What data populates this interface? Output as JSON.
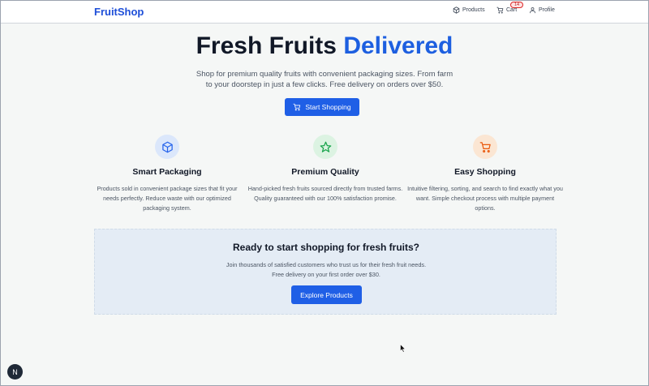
{
  "header": {
    "brand": "FruitShop",
    "nav": {
      "products": "Products",
      "cart": "Cart",
      "cart_count": "14",
      "profile": "Profile"
    }
  },
  "hero": {
    "title_main": "Fresh Fruits",
    "title_accent": "Delivered",
    "subtitle": "Shop for premium quality fruits with convenient packaging sizes. From farm to your doorstep in just a few clicks. Free delivery on orders over $50.",
    "cta_label": "Start Shopping"
  },
  "features": [
    {
      "icon": "package-icon",
      "title": "Smart Packaging",
      "description": "Products sold in convenient package sizes that fit your needs perfectly. Reduce waste with our optimized packaging system.",
      "color": "#2563eb",
      "bg": "#dbe7fb"
    },
    {
      "icon": "star-icon",
      "title": "Premium Quality",
      "description": "Hand-picked fresh fruits sourced directly from trusted farms. Quality guaranteed with our 100% satisfaction promise.",
      "color": "#16a34a",
      "bg": "#dcf3e2"
    },
    {
      "icon": "cart-icon",
      "title": "Easy Shopping",
      "description": "Intuitive filtering, sorting, and search to find exactly what you want. Simple checkout process with multiple payment options.",
      "color": "#ea580c",
      "bg": "#fbe6d3"
    }
  ],
  "cta": {
    "title": "Ready to start shopping for fresh fruits?",
    "subtitle": "Join thousands of satisfied customers who trust us for their fresh fruit needs. Free delivery on your first order over $30.",
    "button": "Explore Products"
  },
  "fab": {
    "label": "N"
  },
  "colors": {
    "accent": "#1d5fe0",
    "button": "#1f5fe6"
  }
}
